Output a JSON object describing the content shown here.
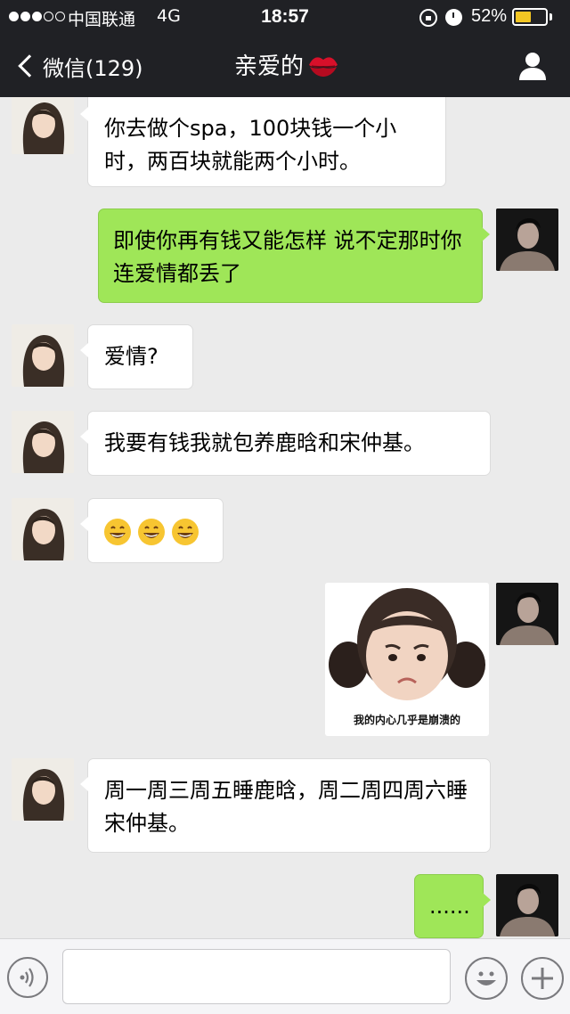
{
  "status_bar": {
    "carrier": "中国联通",
    "network": "4G",
    "time": "18:57",
    "battery_percent": "52%",
    "battery_level": 0.52,
    "signal_bars_filled": 3,
    "signal_bars_total": 5
  },
  "nav": {
    "back_label": "微信(129)",
    "title": "亲爱的"
  },
  "messages": [
    {
      "from": "her",
      "text": "你去做个spa，100块钱一个小时，两百块就能两个小时。"
    },
    {
      "from": "me",
      "text": "即使你再有钱又能怎样 说不定那时你连爱情都丢了"
    },
    {
      "from": "her",
      "text": "爱情?"
    },
    {
      "from": "her",
      "text": "我要有钱我就包养鹿晗和宋仲基。"
    },
    {
      "from": "her",
      "emoji": [
        "grinning-face",
        "grinning-face",
        "grinning-face"
      ]
    },
    {
      "from": "me",
      "sticker_caption": "我的内心几乎是崩溃的"
    },
    {
      "from": "her",
      "text": "周一周三周五睡鹿晗，周二周四周六睡宋仲基。"
    },
    {
      "from": "me",
      "text": "......"
    }
  ],
  "colors": {
    "header_bg": "#202125",
    "chat_bg": "#ebebeb",
    "bubble_out": "#9fe658",
    "bubble_in": "#ffffff",
    "battery": "#f3c623",
    "kiss": "#d8102a"
  },
  "icons": {
    "back": "chevron-left-icon",
    "profile": "person-icon",
    "title_emoji": "kiss-mark-icon",
    "voice": "voice-icon",
    "emoji": "smiley-icon",
    "more": "plus-icon"
  }
}
